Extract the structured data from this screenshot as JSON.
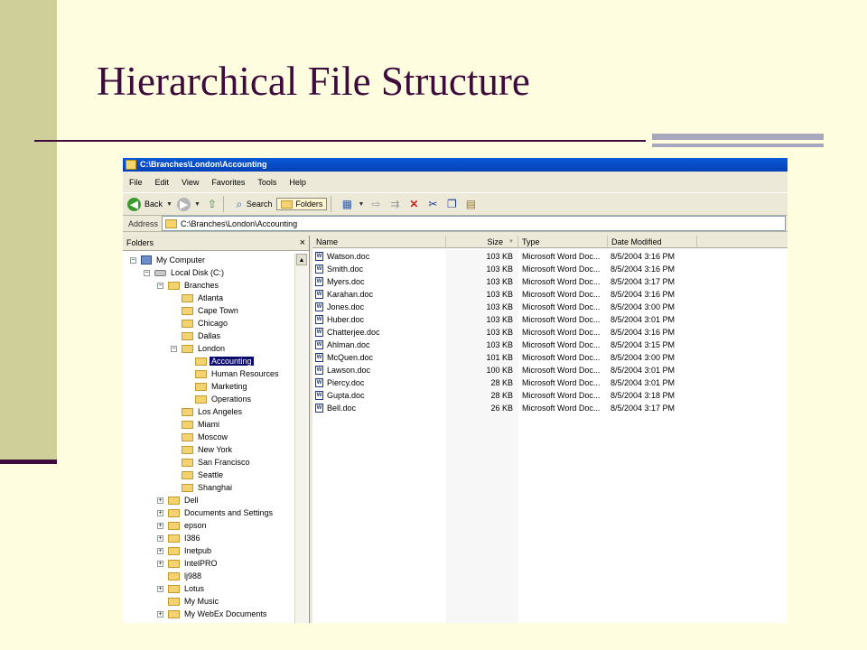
{
  "slide": {
    "title": "Hierarchical File Structure"
  },
  "window": {
    "title": "C:\\Branches\\London\\Accounting",
    "menu": [
      "File",
      "Edit",
      "View",
      "Favorites",
      "Tools",
      "Help"
    ],
    "toolbar": {
      "back_label": "Back",
      "search_label": "Search",
      "folders_label": "Folders"
    },
    "address": {
      "label": "Address",
      "value": "C:\\Branches\\London\\Accounting"
    },
    "folders_pane": {
      "header": "Folders",
      "close_glyph": "×",
      "tree": [
        {
          "label": "My Computer",
          "depth": 0,
          "expander": "−",
          "icon": "computer-icon"
        },
        {
          "label": "Local Disk (C:)",
          "depth": 1,
          "expander": "−",
          "icon": "disk-icon"
        },
        {
          "label": "Branches",
          "depth": 2,
          "expander": "−",
          "icon": "folder-icon"
        },
        {
          "label": "Atlanta",
          "depth": 3,
          "expander": "",
          "icon": "folder-icon"
        },
        {
          "label": "Cape Town",
          "depth": 3,
          "expander": "",
          "icon": "folder-icon"
        },
        {
          "label": "Chicago",
          "depth": 3,
          "expander": "",
          "icon": "folder-icon"
        },
        {
          "label": "Dallas",
          "depth": 3,
          "expander": "",
          "icon": "folder-icon"
        },
        {
          "label": "London",
          "depth": 3,
          "expander": "−",
          "icon": "folder-icon"
        },
        {
          "label": "Accounting",
          "depth": 4,
          "expander": "",
          "icon": "folder-icon",
          "selected": true
        },
        {
          "label": "Human Resources",
          "depth": 4,
          "expander": "",
          "icon": "folder-icon"
        },
        {
          "label": "Marketing",
          "depth": 4,
          "expander": "",
          "icon": "folder-icon"
        },
        {
          "label": "Operations",
          "depth": 4,
          "expander": "",
          "icon": "folder-icon"
        },
        {
          "label": "Los Angeles",
          "depth": 3,
          "expander": "",
          "icon": "folder-icon"
        },
        {
          "label": "Miami",
          "depth": 3,
          "expander": "",
          "icon": "folder-icon"
        },
        {
          "label": "Moscow",
          "depth": 3,
          "expander": "",
          "icon": "folder-icon"
        },
        {
          "label": "New York",
          "depth": 3,
          "expander": "",
          "icon": "folder-icon"
        },
        {
          "label": "San Francisco",
          "depth": 3,
          "expander": "",
          "icon": "folder-icon"
        },
        {
          "label": "Seattle",
          "depth": 3,
          "expander": "",
          "icon": "folder-icon"
        },
        {
          "label": "Shanghai",
          "depth": 3,
          "expander": "",
          "icon": "folder-icon"
        },
        {
          "label": "Dell",
          "depth": 2,
          "expander": "+",
          "icon": "folder-icon"
        },
        {
          "label": "Documents and Settings",
          "depth": 2,
          "expander": "+",
          "icon": "folder-icon"
        },
        {
          "label": "epson",
          "depth": 2,
          "expander": "+",
          "icon": "folder-icon"
        },
        {
          "label": "I386",
          "depth": 2,
          "expander": "+",
          "icon": "folder-icon"
        },
        {
          "label": "Inetpub",
          "depth": 2,
          "expander": "+",
          "icon": "folder-icon"
        },
        {
          "label": "IntelPRO",
          "depth": 2,
          "expander": "+",
          "icon": "folder-icon"
        },
        {
          "label": "lj988",
          "depth": 2,
          "expander": "",
          "icon": "folder-icon"
        },
        {
          "label": "Lotus",
          "depth": 2,
          "expander": "+",
          "icon": "folder-icon"
        },
        {
          "label": "My Music",
          "depth": 2,
          "expander": "",
          "icon": "folder-icon"
        },
        {
          "label": "My WebEx Documents",
          "depth": 2,
          "expander": "+",
          "icon": "folder-icon"
        }
      ]
    },
    "file_list": {
      "columns": [
        "Name",
        "Size",
        "Type",
        "Date Modified"
      ],
      "rows": [
        {
          "name": "Watson.doc",
          "size": "103 KB",
          "type": "Microsoft Word Doc...",
          "date": "8/5/2004 3:16 PM"
        },
        {
          "name": "Smith.doc",
          "size": "103 KB",
          "type": "Microsoft Word Doc...",
          "date": "8/5/2004 3:16 PM"
        },
        {
          "name": "Myers.doc",
          "size": "103 KB",
          "type": "Microsoft Word Doc...",
          "date": "8/5/2004 3:17 PM"
        },
        {
          "name": "Karahan.doc",
          "size": "103 KB",
          "type": "Microsoft Word Doc...",
          "date": "8/5/2004 3:16 PM"
        },
        {
          "name": "Jones.doc",
          "size": "103 KB",
          "type": "Microsoft Word Doc...",
          "date": "8/5/2004 3:00 PM"
        },
        {
          "name": "Huber.doc",
          "size": "103 KB",
          "type": "Microsoft Word Doc...",
          "date": "8/5/2004 3:01 PM"
        },
        {
          "name": "Chatterjee.doc",
          "size": "103 KB",
          "type": "Microsoft Word Doc...",
          "date": "8/5/2004 3:16 PM"
        },
        {
          "name": "Ahlman.doc",
          "size": "103 KB",
          "type": "Microsoft Word Doc...",
          "date": "8/5/2004 3:15 PM"
        },
        {
          "name": "McQuen.doc",
          "size": "101 KB",
          "type": "Microsoft Word Doc...",
          "date": "8/5/2004 3:00 PM"
        },
        {
          "name": "Lawson.doc",
          "size": "100 KB",
          "type": "Microsoft Word Doc...",
          "date": "8/5/2004 3:01 PM"
        },
        {
          "name": "Piercy.doc",
          "size": "28 KB",
          "type": "Microsoft Word Doc...",
          "date": "8/5/2004 3:01 PM"
        },
        {
          "name": "Gupta.doc",
          "size": "28 KB",
          "type": "Microsoft Word Doc...",
          "date": "8/5/2004 3:18 PM"
        },
        {
          "name": "Bell.doc",
          "size": "26 KB",
          "type": "Microsoft Word Doc...",
          "date": "8/5/2004 3:17 PM"
        }
      ]
    }
  }
}
